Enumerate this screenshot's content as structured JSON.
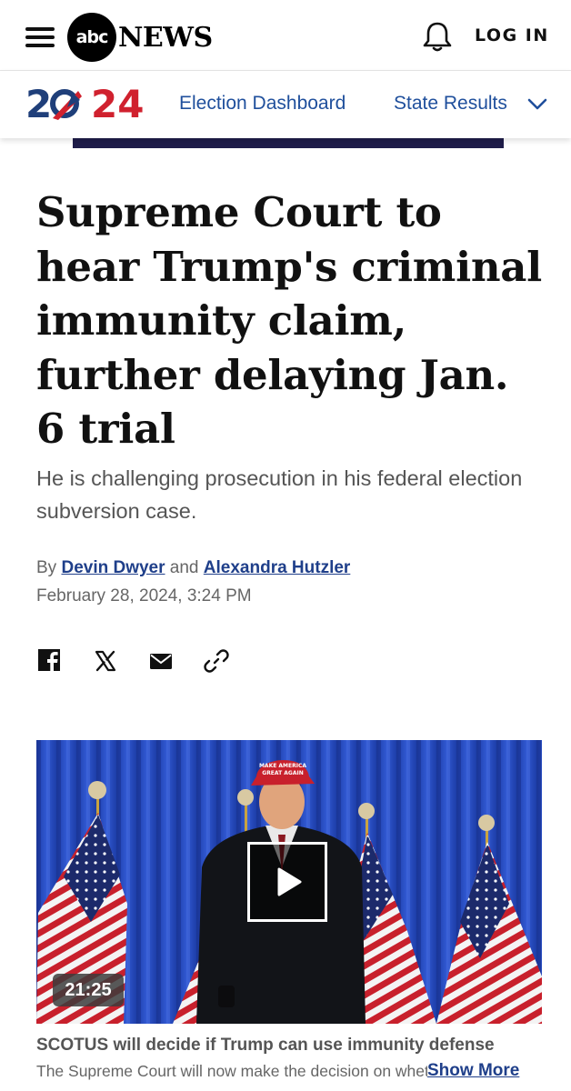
{
  "header": {
    "logo_abc": "abc",
    "logo_news": "NEWS",
    "login_label": "LOG IN"
  },
  "election_bar": {
    "logo_text": "2024",
    "links": [
      {
        "label": "Election Dashboard"
      },
      {
        "label": "State Results"
      }
    ]
  },
  "article": {
    "headline": "Supreme Court to hear Trump's criminal immunity claim, further delaying Jan. 6 trial",
    "subhead": "He is challenging prosecution in his federal election subversion case.",
    "byline_prefix": "By",
    "byline_join": "and",
    "authors": [
      "Devin Dwyer",
      "Alexandra Hutzler"
    ],
    "date": "February 28, 2024, 3:24 PM"
  },
  "share_icons": [
    "facebook-icon",
    "x-icon",
    "email-icon",
    "link-icon"
  ],
  "video": {
    "duration": "21:25",
    "hat_text_1": "MAKE AMERICA",
    "hat_text_2": "GREAT AGAIN",
    "title": "SCOTUS will decide if Trump can use immunity defense",
    "description": "The Supreme Court will now make the decision on whet...",
    "show_more_label": "Show More"
  },
  "colors": {
    "link_blue": "#1f4f9c",
    "brand_red": "#d0212e",
    "stage_blue": "#2a4fc4"
  }
}
